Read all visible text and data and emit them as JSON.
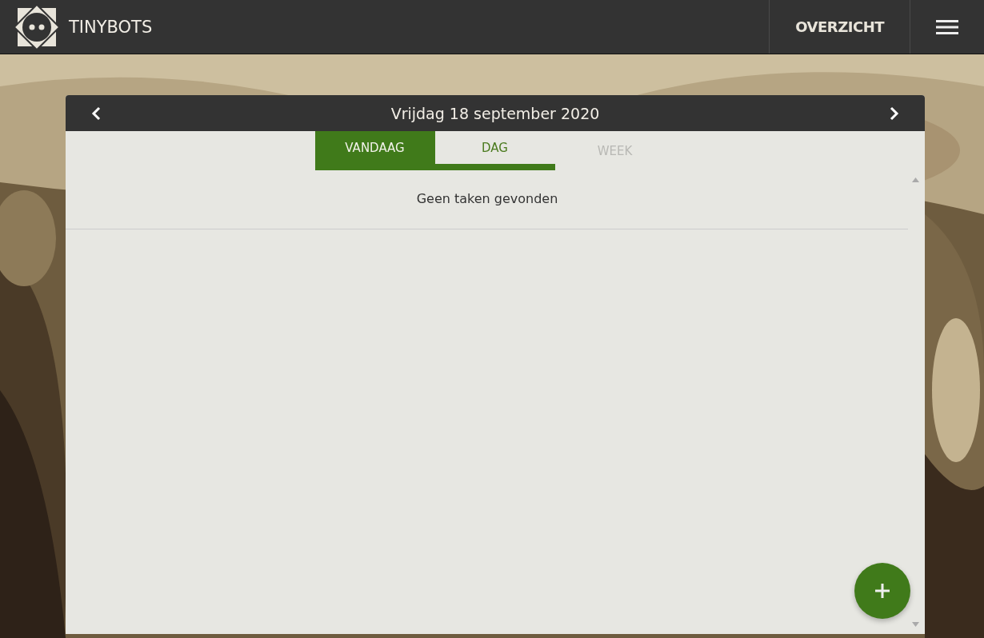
{
  "brand": {
    "name": "TINYBOTS"
  },
  "nav": {
    "label": "OVERZICHT"
  },
  "calendar": {
    "date": "Vrijdag 18 september 2020",
    "tabs": [
      {
        "label": "VANDAAG",
        "selected": true,
        "underlined": true,
        "disabled": false
      },
      {
        "label": "DAG",
        "selected": false,
        "underlined": true,
        "disabled": false
      },
      {
        "label": "WEEK",
        "selected": false,
        "underlined": false,
        "disabled": true
      }
    ],
    "empty_message": "Geen taken gevonden"
  }
}
